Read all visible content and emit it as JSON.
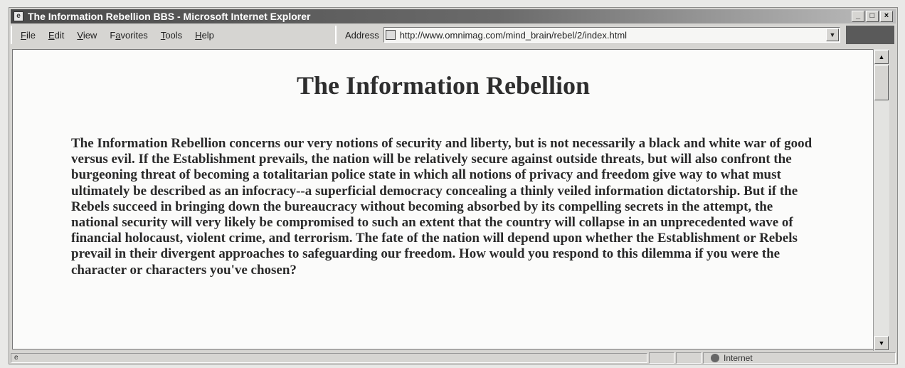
{
  "window": {
    "title": "The Information Rebellion BBS - Microsoft Internet Explorer",
    "buttons": [
      "_",
      "□",
      "×"
    ]
  },
  "menu": [
    {
      "label": "File",
      "mnemonic": 0
    },
    {
      "label": "Edit",
      "mnemonic": 0
    },
    {
      "label": "View",
      "mnemonic": 0
    },
    {
      "label": "Favorites",
      "mnemonic": 1
    },
    {
      "label": "Tools",
      "mnemonic": 0
    },
    {
      "label": "Help",
      "mnemonic": 0
    }
  ],
  "address": {
    "label": "Address",
    "url": "http://www.omnimag.com/mind_brain/rebel/2/index.html"
  },
  "page": {
    "heading": "The Information Rebellion",
    "paragraph": "The Information Rebellion concerns our very notions of security and liberty, but is not necessarily a black and white war of good versus evil. If the Establishment prevails, the nation will be relatively secure against outside threats, but will also confront the burgeoning threat of becoming a totalitarian police state in which all notions of privacy and freedom give way to what must ultimately be described as an infocracy--a superficial democracy concealing a thinly veiled information dictatorship. But if the Rebels succeed in bringing down the bureaucracy without becoming absorbed by its compelling secrets in the attempt, the national security will very likely be compromised to such an extent that the country will collapse in an unprecedented wave of financial holocaust, violent crime, and terrorism. The fate of the nation will depend upon whether the Establishment or Rebels prevail in their divergent approaches to safeguarding our freedom. How would you respond to this dilemma if you were the character or characters you've chosen?"
  },
  "status": {
    "zone": "Internet"
  }
}
